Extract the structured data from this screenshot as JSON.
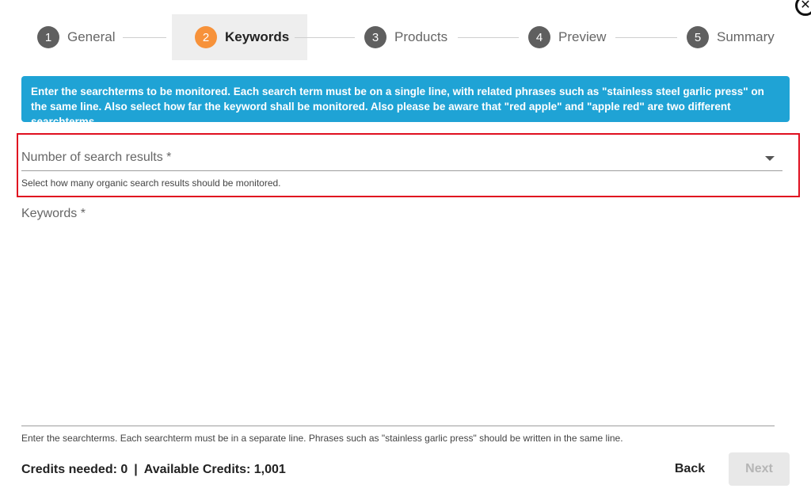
{
  "dialog": {
    "close_glyph": "✕"
  },
  "stepper": {
    "steps": [
      {
        "number": "1",
        "label": "General"
      },
      {
        "number": "2",
        "label": "Keywords"
      },
      {
        "number": "3",
        "label": "Products"
      },
      {
        "number": "4",
        "label": "Preview"
      },
      {
        "number": "5",
        "label": "Summary"
      }
    ],
    "active_step": 2,
    "active_color": "#f7923a",
    "inactive_color": "#5f5f5f"
  },
  "info": {
    "text": "Enter the searchterms to be monitored. Each search term must be on a single line, with related phrases such as \"stainless steel garlic press\" on the same line. Also select how far the keyword shall be monitored. Also please be aware that \"red apple\" and \"apple red\" are two different searchterms.",
    "background": "#1fa3d5"
  },
  "form": {
    "search_results": {
      "label": "Number of search results *",
      "helper": "Select how many organic search results should be monitored."
    },
    "keywords": {
      "label": "Keywords *",
      "value": "",
      "helper": "Enter the searchterms. Each searchterm must be in a separate line. Phrases such as \"stainless garlic press\" should be written in the same line."
    }
  },
  "footer": {
    "credits_needed": "Credits needed: 0",
    "separator": "|",
    "available_credits": "Available Credits: 1,001",
    "back_label": "Back",
    "next_label": "Next"
  },
  "highlight_color": "#e01020"
}
